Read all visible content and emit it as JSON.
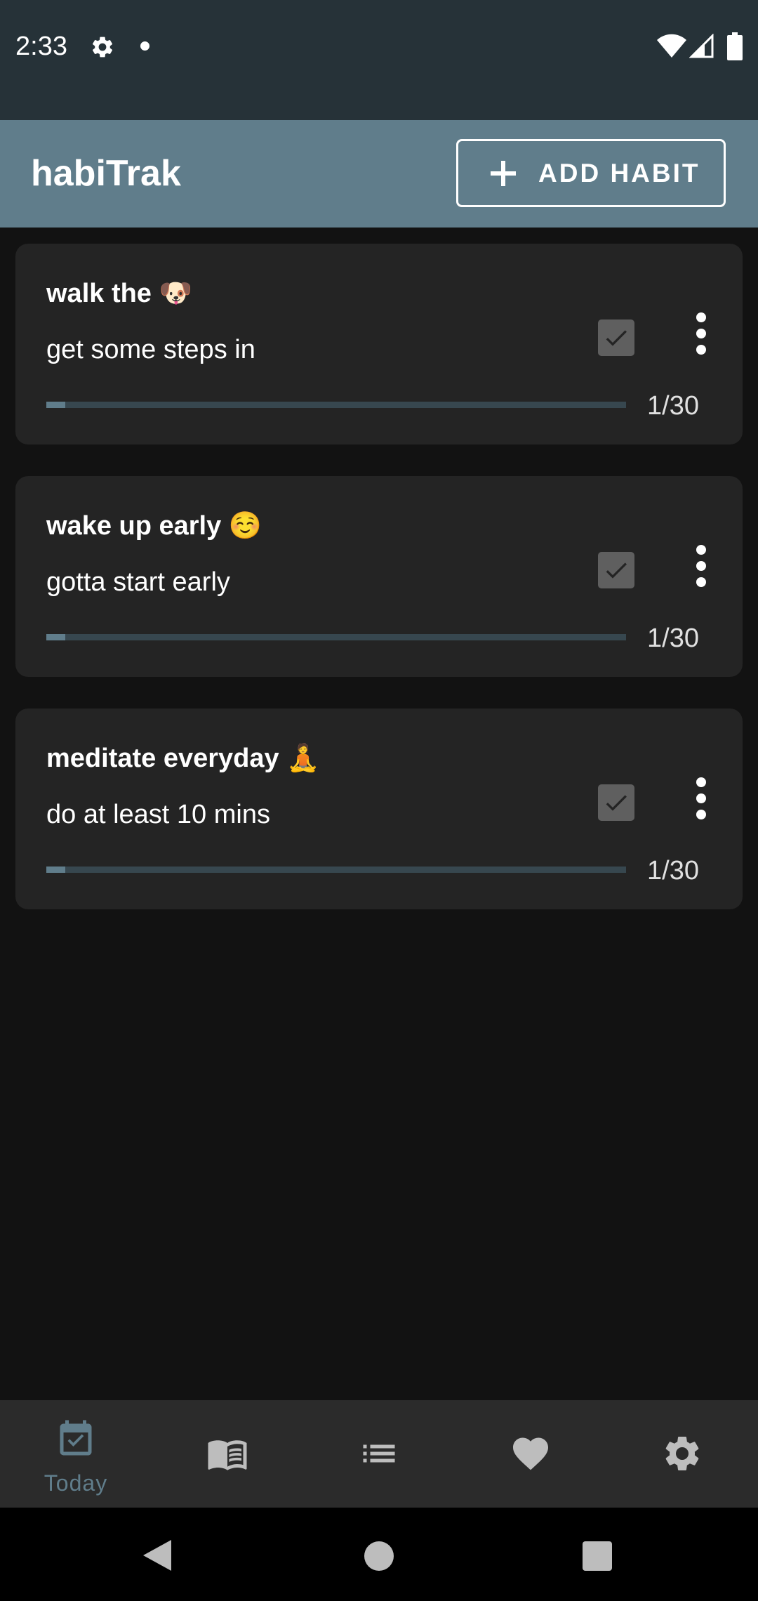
{
  "status_bar": {
    "time": "2:33",
    "icons": [
      "settings-icon",
      "notification-dot-icon",
      "wifi-icon",
      "signal-icon",
      "battery-icon"
    ]
  },
  "app_bar": {
    "title": "habiTrak",
    "add_button_label": "ADD HABIT"
  },
  "habits": [
    {
      "title": "walk the 🐶",
      "description": "get some steps in",
      "count": "1/30",
      "progress": 0.033,
      "checked": true
    },
    {
      "title": "wake up early ☺️",
      "description": "gotta start early",
      "count": "1/30",
      "progress": 0.033,
      "checked": true
    },
    {
      "title": "meditate everyday 🧘",
      "description": "do at least 10 mins",
      "count": "1/30",
      "progress": 0.033,
      "checked": true
    }
  ],
  "bottom_nav": {
    "items": [
      {
        "label": "Today",
        "icon": "calendar-check-icon",
        "active": true
      },
      {
        "label": "",
        "icon": "book-icon",
        "active": false
      },
      {
        "label": "",
        "icon": "list-icon",
        "active": false
      },
      {
        "label": "",
        "icon": "heart-icon",
        "active": false
      },
      {
        "label": "",
        "icon": "settings-icon",
        "active": false
      }
    ]
  },
  "colors": {
    "status_bar": "#263238",
    "app_bar": "#607d8b",
    "background": "#121212",
    "card": "#242424",
    "accent": "#607d8b",
    "inactive_icon": "#bdbdbd"
  }
}
